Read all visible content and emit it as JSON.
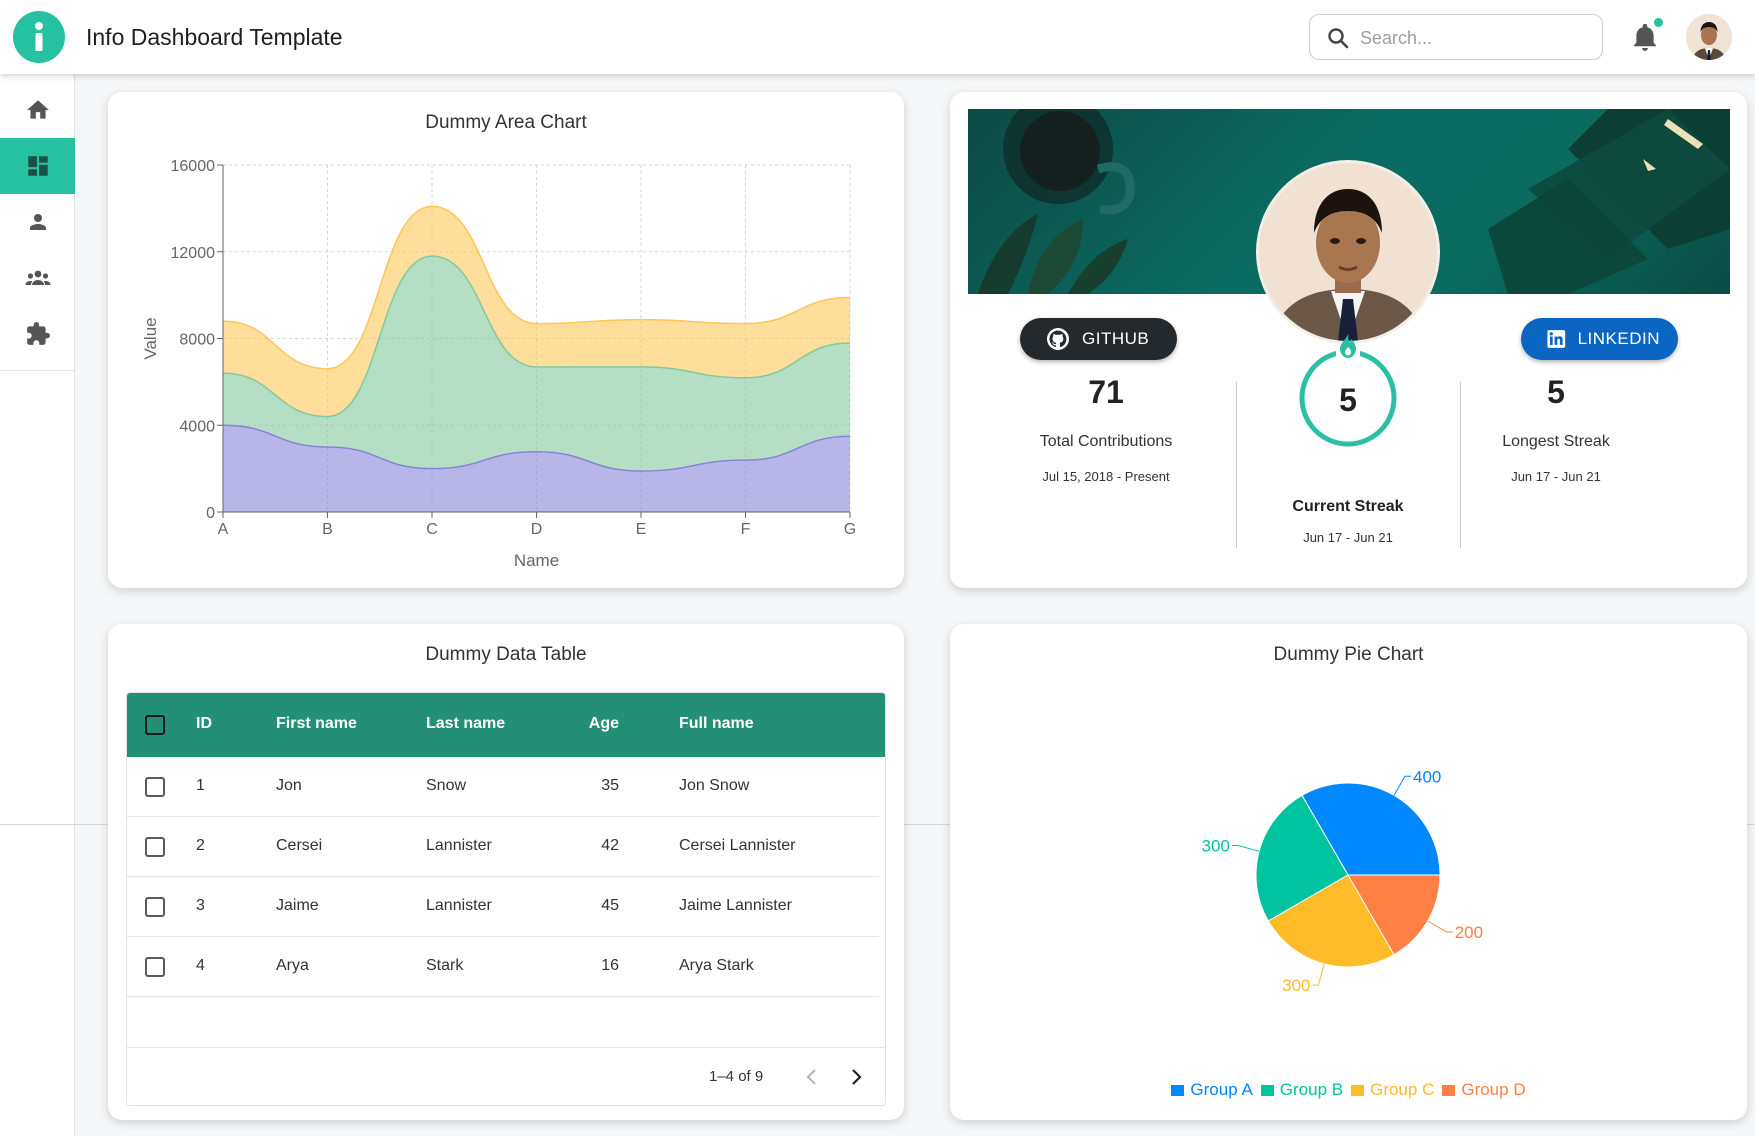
{
  "header": {
    "title": "Info Dashboard Template",
    "search_placeholder": "Search...",
    "logo_icon": "info-icon",
    "accent_color": "#26c1a1"
  },
  "sidebar": {
    "items": [
      {
        "icon": "home-icon",
        "active": false
      },
      {
        "icon": "dashboard-icon",
        "active": true
      },
      {
        "icon": "person-icon",
        "active": false
      },
      {
        "icon": "group-icon",
        "active": false
      },
      {
        "icon": "extension-icon",
        "active": false
      }
    ]
  },
  "area_chart": {
    "title": "Dummy Area Chart"
  },
  "profile": {
    "github_label": "GITHUB",
    "linkedin_label": "LINKEDIN",
    "total_contributions": "71",
    "total_contributions_label": "Total Contributions",
    "total_contributions_range": "Jul 15, 2018 - Present",
    "current_streak": "5",
    "current_streak_label": "Current Streak",
    "current_streak_range": "Jun 17 - Jun 21",
    "longest_streak": "5",
    "longest_streak_label": "Longest Streak",
    "longest_streak_range": "Jun 17 - Jun 21"
  },
  "table": {
    "title": "Dummy Data Table",
    "columns": [
      "ID",
      "First name",
      "Last name",
      "Age",
      "Full name"
    ],
    "rows": [
      {
        "id": "1",
        "first": "Jon",
        "last": "Snow",
        "age": "35",
        "full": "Jon Snow"
      },
      {
        "id": "2",
        "first": "Cersei",
        "last": "Lannister",
        "age": "42",
        "full": "Cersei Lannister"
      },
      {
        "id": "3",
        "first": "Jaime",
        "last": "Lannister",
        "age": "45",
        "full": "Jaime Lannister"
      },
      {
        "id": "4",
        "first": "Arya",
        "last": "Stark",
        "age": "16",
        "full": "Arya Stark"
      }
    ],
    "pagination": "1–4 of 9"
  },
  "pie_chart": {
    "title": "Dummy Pie Chart"
  },
  "chart_data": [
    {
      "type": "area",
      "title": "Dummy Area Chart",
      "xlabel": "Name",
      "ylabel": "Value",
      "categories": [
        "A",
        "B",
        "C",
        "D",
        "E",
        "F",
        "G"
      ],
      "ylim": [
        0,
        16000
      ],
      "yticks": [
        0,
        4000,
        8000,
        12000,
        16000
      ],
      "stacked": true,
      "grid": true,
      "series": [
        {
          "color": "#8884d8",
          "values": [
            4000,
            3000,
            2000,
            2780,
            1890,
            2390,
            3490
          ]
        },
        {
          "color": "#82ca9d",
          "values": [
            2400,
            1398,
            9800,
            3908,
            4800,
            3800,
            4300
          ]
        },
        {
          "color": "#ffc658",
          "values": [
            2400,
            2210,
            2290,
            2000,
            2181,
            2500,
            2100
          ]
        }
      ]
    },
    {
      "type": "pie",
      "title": "Dummy Pie Chart",
      "legend_position": "bottom",
      "series": [
        {
          "name": "Group A",
          "value": 400,
          "color": "#0088FE"
        },
        {
          "name": "Group B",
          "value": 300,
          "color": "#00C49F"
        },
        {
          "name": "Group C",
          "value": 300,
          "color": "#FFBB28"
        },
        {
          "name": "Group D",
          "value": 200,
          "color": "#FF8042"
        }
      ]
    }
  ]
}
